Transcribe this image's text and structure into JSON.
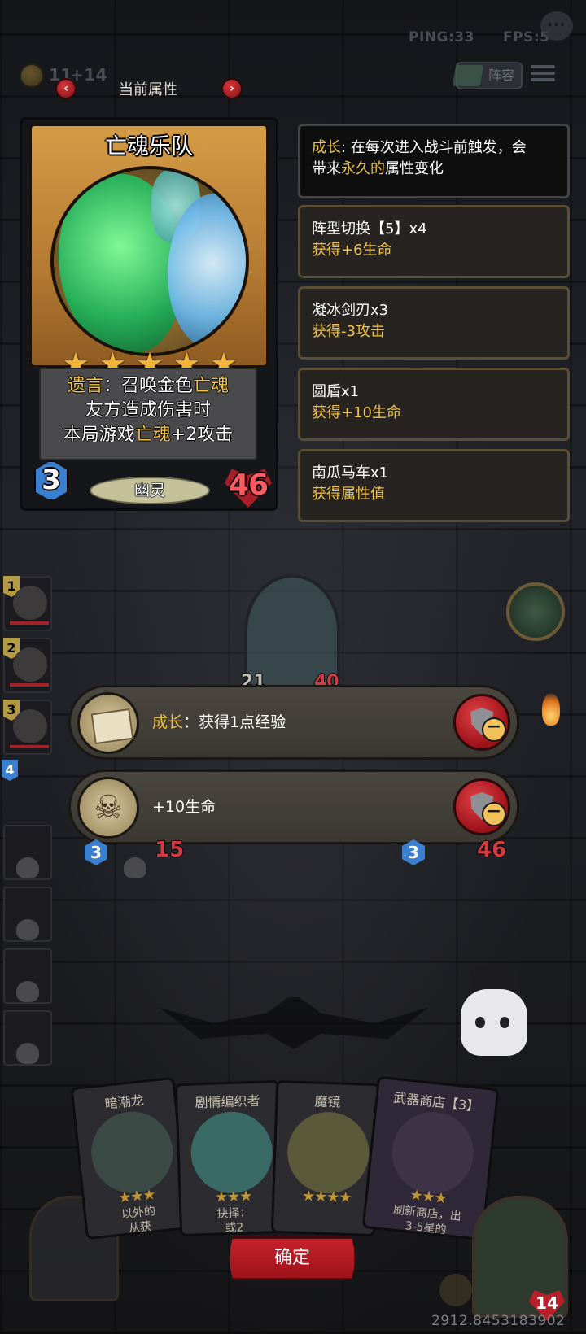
{
  "hud": {
    "ping": "PING:33",
    "fps": "FPS:5",
    "gold": "11",
    "gold_income": "+14",
    "lineup_label": "阵容"
  },
  "header": {
    "title": "当前属性",
    "prev_icon": "chevron-left-icon",
    "next_icon": "chevron-right-icon"
  },
  "card": {
    "name": "亡魂乐队",
    "stars": 5,
    "star_glyph": "★",
    "desc_line1_a": "遗言",
    "desc_line1_b": "：召唤金色",
    "desc_line1_c": "亡魂",
    "desc_line2": "友方造成伤害时",
    "desc_line3_a": "本局游戏",
    "desc_line3_b": "亡魂",
    "desc_line3_c": "+2攻击",
    "cost": "3",
    "tribe": "幽灵",
    "health": "46"
  },
  "info_panels": {
    "intro_a": "成长",
    "intro_b": ": 在每次进入战斗前触发，会",
    "intro_c": "带来",
    "intro_d": "永久的",
    "intro_e": "属性变化",
    "items": [
      {
        "title": "阵型切换【5】x4",
        "effect": "获得+6生命"
      },
      {
        "title": "凝冰剑刃x3",
        "effect": "获得-3攻击"
      },
      {
        "title": "圆盾x1",
        "effect": "获得+10生命"
      },
      {
        "title": "南瓜马车x1",
        "effect": "获得属性值"
      }
    ]
  },
  "roster": {
    "slots": [
      "1",
      "2",
      "3",
      "4"
    ]
  },
  "board": {
    "mid_attack": "21",
    "mid_health": "40",
    "left_cost": "3",
    "left_health": "15",
    "right_cost": "3",
    "right_health": "46"
  },
  "effects": [
    {
      "label_hl": "成长",
      "label_rest": "：获得1点经验",
      "icon": "map-scroll-icon"
    },
    {
      "label_hl": "",
      "label_rest": "+10生命",
      "icon": "skull-coin-icon"
    }
  ],
  "hand": [
    {
      "name": "暗潮龙",
      "stars": "★★★",
      "text": "以外的\n从获"
    },
    {
      "name": "剧情编织者",
      "stars": "★★★",
      "text": "抉择：\n或2"
    },
    {
      "name": "魔镜",
      "stars": "★★★★",
      "text": ""
    },
    {
      "name": "武器商店【3】",
      "stars": "★★★",
      "text": "刷新商店，出\n3-5星的"
    }
  ],
  "confirm_label": "确定",
  "goblin_health": "14",
  "seed": "2912.8453183902"
}
